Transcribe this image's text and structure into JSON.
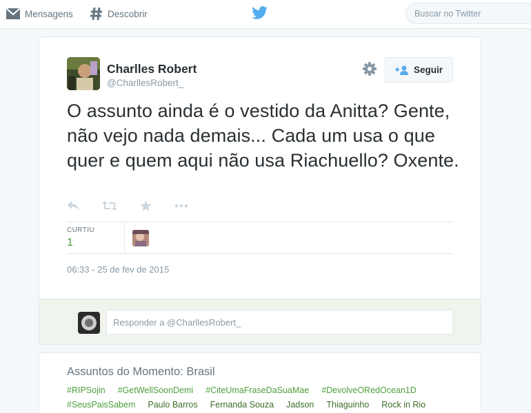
{
  "topbar": {
    "messages_label": "Mensagens",
    "discover_label": "Descobrir",
    "search_placeholder": "Buscar no Twitter"
  },
  "tweet": {
    "author_name": "Charlles Robert",
    "author_handle": "@CharllesRobert_",
    "follow_label": "Seguir",
    "text": "O assunto ainda é o vestido da Anitta? Gente, não vejo nada demais... Cada um usa o que quer e quem aqui não usa Riachuello? Oxente.",
    "favorites_label": "CURTIU",
    "favorites_count": "1",
    "timestamp": "06:33 - 25 de fev de 2015",
    "reply_placeholder": "Responder a @CharllesRobert_"
  },
  "trends": {
    "title": "Assuntos do Momento: Brasil",
    "row1": [
      "#RIPSojin",
      "#GetWellSoonDemi",
      "#CiteUmaFraseDaSuaMae",
      "#DevolveORedOcean1D"
    ],
    "row2": [
      "#SeusPaisSabem",
      "Paulo Barros",
      "Fernanda Souza",
      "Jadson",
      "Thiaguinho",
      "Rock in Rio"
    ]
  },
  "icons": [
    "envelope-icon",
    "hash-icon",
    "twitter-bird-icon",
    "gear-icon",
    "follow-person-icon",
    "reply-icon",
    "retweet-icon",
    "favorite-star-icon",
    "more-icon"
  ],
  "colors": {
    "brand": "#55acee",
    "accent_green": "#4d9e3a",
    "reply_bg": "#eff5ec",
    "page_bg": "#f5f8fa"
  }
}
